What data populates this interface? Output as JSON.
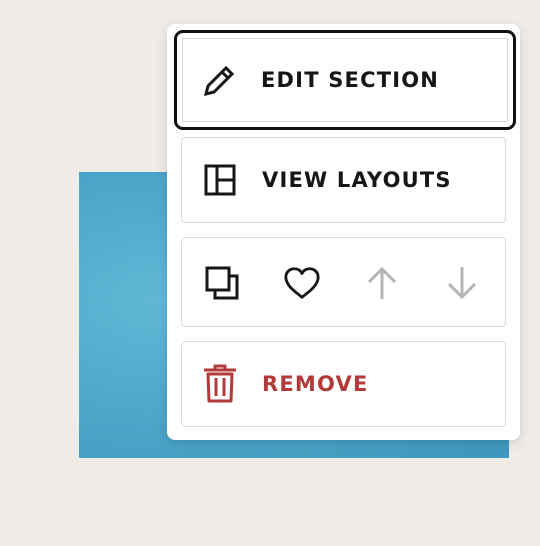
{
  "menu": {
    "edit_section_label": "EDIT SECTION",
    "view_layouts_label": "VIEW LAYOUTS",
    "remove_label": "REMOVE"
  },
  "icons": {
    "edit": "pencil-icon",
    "layouts": "layout-icon",
    "duplicate": "duplicate-icon",
    "favorite": "heart-icon",
    "move_up": "arrow-up-icon",
    "move_down": "arrow-down-icon",
    "remove": "trash-icon"
  },
  "colors": {
    "background": "#efebe6",
    "preview_blue": "#4fa9cb",
    "text": "#161616",
    "danger": "#b23a3a",
    "disabled": "#b4b4b4",
    "card_border": "#dedad5",
    "active_border": "#111111"
  }
}
